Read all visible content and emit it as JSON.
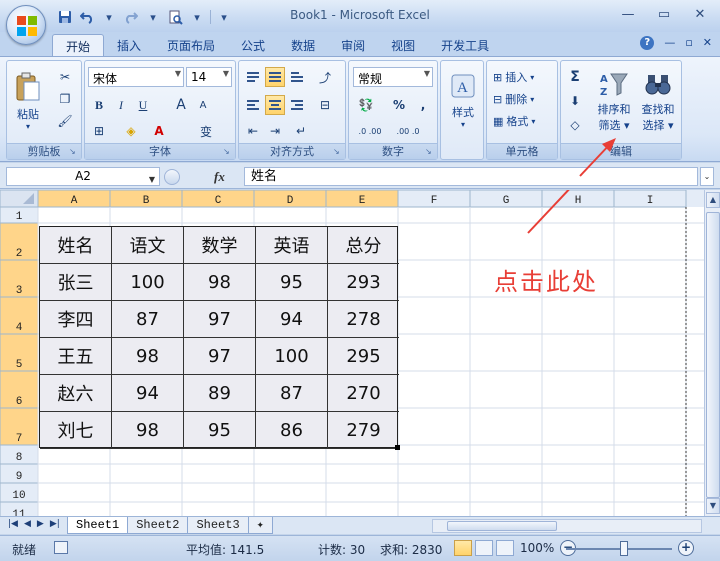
{
  "window": {
    "title": "Book1 - Microsoft Excel",
    "minimize_icon": "minimize-icon",
    "maximize_icon": "restore-icon",
    "close_icon": "close-icon"
  },
  "qat": {
    "save_icon": "save-icon",
    "undo_icon": "undo-icon",
    "redo_icon": "redo-icon",
    "preview_icon": "print-preview-icon"
  },
  "tabs": [
    "开始",
    "插入",
    "页面布局",
    "公式",
    "数据",
    "审阅",
    "视图",
    "开发工具"
  ],
  "ribbon": {
    "clipboard": {
      "label": "剪贴板",
      "paste": "粘贴"
    },
    "font": {
      "label": "字体",
      "name": "宋体",
      "size": "14",
      "bold": "B",
      "italic": "I",
      "underline": "U",
      "grow": "A",
      "shrink": "A",
      "wen": "变"
    },
    "alignment": {
      "label": "对齐方式"
    },
    "number": {
      "label": "数字",
      "format": "常规",
      "percent": "%",
      "comma": ",",
      "inc_decimal": ".0 .00",
      "dec_decimal": ".00 .0"
    },
    "styles": {
      "label": "样式"
    },
    "cells": {
      "label": "单元格",
      "insert": "插入",
      "delete": "删除",
      "format": "格式"
    },
    "editing": {
      "label": "编辑",
      "sigma": "Σ",
      "sort_filter_line1": "排序和",
      "sort_filter_line2": "筛选",
      "find_select_line1": "查找和",
      "find_select_line2": "选择"
    }
  },
  "formula_bar": {
    "name_box": "A2",
    "fx": "fx",
    "content": "姓名"
  },
  "grid": {
    "columns": [
      "A",
      "B",
      "C",
      "D",
      "E",
      "F",
      "G",
      "H",
      "I"
    ],
    "rows": [
      "1",
      "2",
      "3",
      "4",
      "5",
      "6",
      "7",
      "8",
      "9",
      "10",
      "11"
    ],
    "selected_columns": [
      "A",
      "B",
      "C",
      "D",
      "E"
    ],
    "selected_rows": [
      "2",
      "3",
      "4",
      "5",
      "6",
      "7"
    ],
    "header_color": "#ffd58a",
    "table": {
      "header": [
        "姓名",
        "语文",
        "数学",
        "英语",
        "总分"
      ],
      "rows": [
        [
          "张三",
          "100",
          "98",
          "95",
          "293"
        ],
        [
          "李四",
          "87",
          "97",
          "94",
          "278"
        ],
        [
          "王五",
          "98",
          "97",
          "100",
          "295"
        ],
        [
          "赵六",
          "94",
          "89",
          "87",
          "270"
        ],
        [
          "刘七",
          "98",
          "95",
          "86",
          "279"
        ]
      ]
    }
  },
  "annotation": {
    "text": "点击此处",
    "color": "#e83e36"
  },
  "sheets": [
    "Sheet1",
    "Sheet2",
    "Sheet3"
  ],
  "active_sheet": "Sheet1",
  "status": {
    "ready": "就绪",
    "average": "平均值: 141.5",
    "count": "计数: 30",
    "sum": "求和: 2830",
    "zoom": "100%",
    "zoom_out": "−",
    "zoom_in": "+"
  }
}
